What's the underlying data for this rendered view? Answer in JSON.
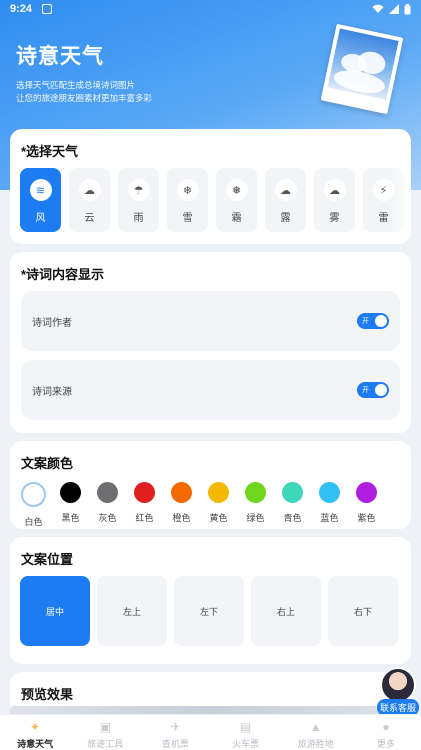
{
  "status_bar": {
    "time": "9:24"
  },
  "hero": {
    "title": "诗意天气",
    "desc_line1": "选择天气匹配生成总境诗词图片",
    "desc_line2": "让您的旅途朋友圈素材更加丰富多彩"
  },
  "weather_section": {
    "title": "*选择天气",
    "items": [
      {
        "label": "风",
        "icon": "wind-icon",
        "glyph": "≋",
        "active": true
      },
      {
        "label": "云",
        "icon": "cloud-sun-icon",
        "glyph": "☁",
        "active": false
      },
      {
        "label": "雨",
        "icon": "rain-icon",
        "glyph": "☂",
        "active": false
      },
      {
        "label": "雪",
        "icon": "snow-icon",
        "glyph": "❄",
        "active": false
      },
      {
        "label": "霜",
        "icon": "frost-icon",
        "glyph": "❅",
        "active": false
      },
      {
        "label": "露",
        "icon": "dew-icon",
        "glyph": "☁",
        "active": false
      },
      {
        "label": "雾",
        "icon": "fog-icon",
        "glyph": "☁",
        "active": false
      },
      {
        "label": "雷",
        "icon": "thunder-icon",
        "glyph": "⚡",
        "active": false
      }
    ]
  },
  "content_section": {
    "title": "*诗词内容显示",
    "toggles": [
      {
        "label": "诗词作者",
        "state": "开"
      },
      {
        "label": "诗词来源",
        "state": "开"
      }
    ]
  },
  "color_section": {
    "title": "文案颜色",
    "colors": [
      {
        "label": "白色",
        "hex": "#ffffff",
        "selected": true
      },
      {
        "label": "黑色",
        "hex": "#000000",
        "selected": false
      },
      {
        "label": "灰色",
        "hex": "#6e6e73",
        "selected": false
      },
      {
        "label": "红色",
        "hex": "#e02020",
        "selected": false
      },
      {
        "label": "橙色",
        "hex": "#f56a00",
        "selected": false
      },
      {
        "label": "黄色",
        "hex": "#f5b800",
        "selected": false
      },
      {
        "label": "绿色",
        "hex": "#6fd61f",
        "selected": false
      },
      {
        "label": "青色",
        "hex": "#3fd6b9",
        "selected": false
      },
      {
        "label": "蓝色",
        "hex": "#33c0f7",
        "selected": false
      },
      {
        "label": "紫色",
        "hex": "#b01fe0",
        "selected": false
      }
    ]
  },
  "position_section": {
    "title": "文案位置",
    "options": [
      {
        "label": "居中",
        "active": true
      },
      {
        "label": "左上",
        "active": false
      },
      {
        "label": "左下",
        "active": false
      },
      {
        "label": "右上",
        "active": false
      },
      {
        "label": "右下",
        "active": false
      }
    ]
  },
  "preview_section": {
    "title": "预览效果"
  },
  "customer_service": {
    "label": "联系客服"
  },
  "tabbar": {
    "tabs": [
      {
        "label": "诗意天气",
        "icon": "bulb-icon",
        "glyph": "✦",
        "active": true
      },
      {
        "label": "旅途工具",
        "icon": "toolbox-icon",
        "glyph": "▣",
        "active": false
      },
      {
        "label": "查机票",
        "icon": "plane-icon",
        "glyph": "✈",
        "active": false
      },
      {
        "label": "火车票",
        "icon": "train-icon",
        "glyph": "▤",
        "active": false
      },
      {
        "label": "旅游胜地",
        "icon": "mountain-icon",
        "glyph": "▲",
        "active": false
      },
      {
        "label": "更多",
        "icon": "user-icon",
        "glyph": "●",
        "active": false
      }
    ]
  },
  "colors": {
    "accent": "#1e7cf2",
    "hero_top": "#2f8cf0",
    "bg": "#eef1f6"
  }
}
